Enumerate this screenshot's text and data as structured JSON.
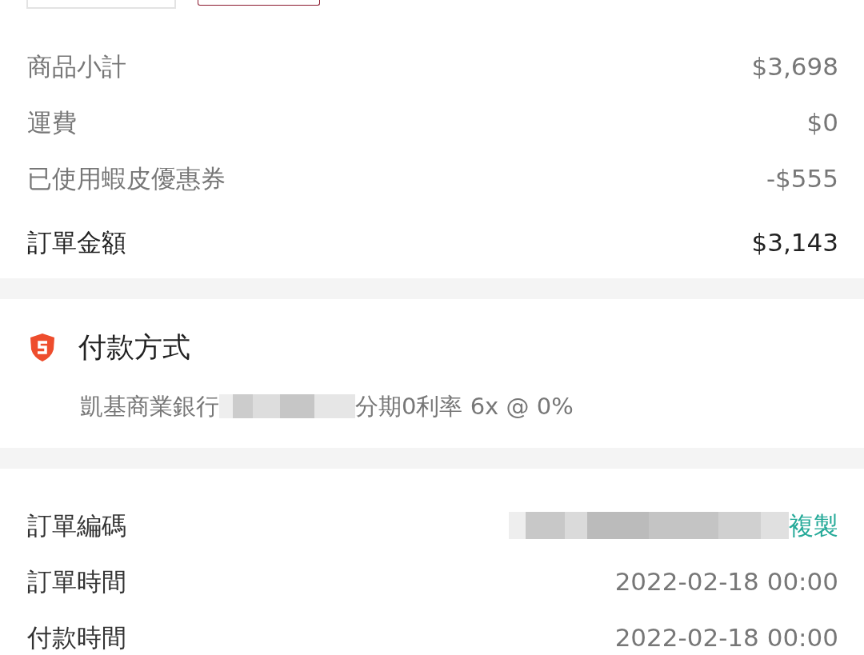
{
  "summary": {
    "rows": [
      {
        "label": "商品小計",
        "value": "$3,698",
        "emphasis": false
      },
      {
        "label": "運費",
        "value": "$0",
        "emphasis": false
      },
      {
        "label": "已使用蝦皮優惠券",
        "value": "-$555",
        "emphasis": false
      },
      {
        "label": "訂單金額",
        "value": "$3,143",
        "emphasis": true
      }
    ]
  },
  "payment": {
    "title": "付款方式",
    "method_prefix": "凱基商業銀行",
    "method_suffix": "分期0利率 6x @ 0%"
  },
  "order_info": {
    "rows": [
      {
        "label": "訂單編碼",
        "kind": "redacted",
        "action": "複製"
      },
      {
        "label": "訂單時間",
        "kind": "text",
        "value": "2022-02-18 00:00"
      },
      {
        "label": "付款時間",
        "kind": "text",
        "value": "2022-02-18 00:00"
      }
    ]
  }
}
